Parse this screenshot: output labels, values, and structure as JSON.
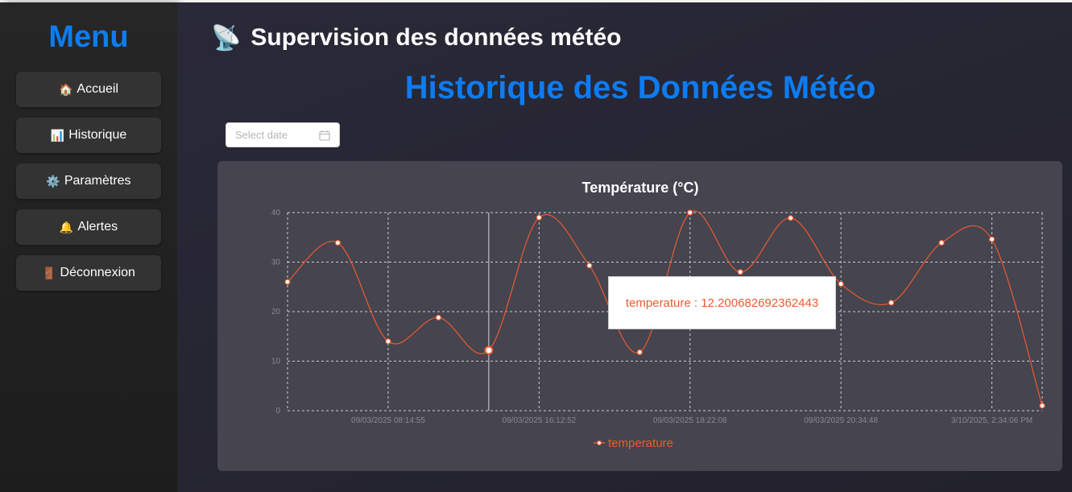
{
  "sidebar": {
    "title": "Menu",
    "items": [
      {
        "icon": "🏠",
        "icon_name": "house-icon",
        "label": "Accueil"
      },
      {
        "icon": "📊",
        "icon_name": "bar-chart-icon",
        "label": "Historique"
      },
      {
        "icon": "⚙️",
        "icon_name": "gear-icon",
        "label": "Paramètres"
      },
      {
        "icon": "🔔",
        "icon_name": "bell-icon",
        "label": "Alertes"
      },
      {
        "icon": "🚪",
        "icon_name": "door-icon",
        "label": "Déconnexion"
      }
    ]
  },
  "header": {
    "icon": "📡",
    "icon_name": "satellite-dish-icon",
    "title": "Supervision des données météo"
  },
  "page": {
    "title": "Historique des Données Météo"
  },
  "date_picker": {
    "placeholder": "Select date",
    "value": ""
  },
  "tooltip": {
    "text": "temperature : 12.200682692362443"
  },
  "colors": {
    "accent": "#0d7cf2",
    "series": "#ef5a2e",
    "card": "#45444f"
  },
  "chart_data": {
    "type": "line",
    "title": "Température (°C)",
    "x": [
      0,
      1,
      2,
      3,
      4,
      5,
      6,
      7,
      8,
      9,
      10,
      11,
      12,
      13,
      14,
      15
    ],
    "x_tick_labels": [
      {
        "at": 2,
        "label": "09/03/2025 08:14:55"
      },
      {
        "at": 5,
        "label": "09/03/2025 16:12:52"
      },
      {
        "at": 8,
        "label": "09/03/2025 18:22:08"
      },
      {
        "at": 11,
        "label": "09/03/2025 20:34:48"
      },
      {
        "at": 14,
        "label": "3/10/2025, 2:34:06 PM"
      }
    ],
    "series": [
      {
        "name": "temperature",
        "values": [
          26.0,
          33.9,
          14.0,
          18.8,
          12.2,
          39.0,
          29.3,
          11.8,
          40.0,
          28.0,
          38.9,
          25.6,
          21.8,
          33.9,
          34.6,
          1.0
        ]
      }
    ],
    "ylim": [
      0,
      40
    ],
    "yticks": [
      0,
      10,
      20,
      30,
      40
    ],
    "highlight_index": 4,
    "grid": true,
    "legend_position": "bottom"
  }
}
